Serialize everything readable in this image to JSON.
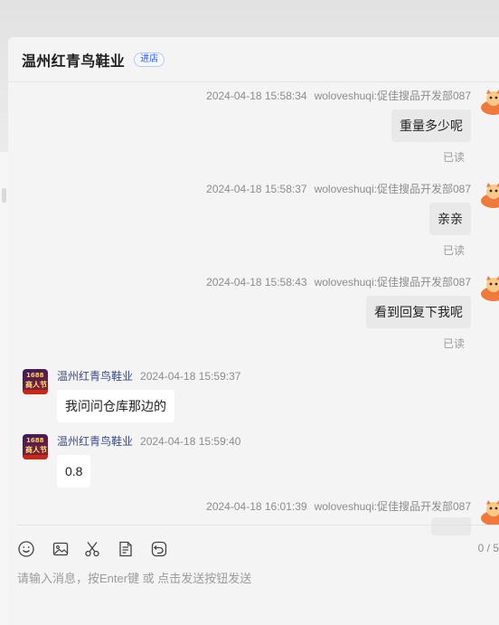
{
  "header": {
    "shop_name": "温州红青鸟鞋业",
    "enter_label": "进店"
  },
  "messages": [
    {
      "side": "right",
      "time": "2024-04-18 15:58:34",
      "sender": "woloveshuqi:促佳搜品开发部087",
      "text": "重量多少呢",
      "status": "已读"
    },
    {
      "side": "right",
      "time": "2024-04-18 15:58:37",
      "sender": "woloveshuqi:促佳搜品开发部087",
      "text": "亲亲",
      "status": "已读"
    },
    {
      "side": "right",
      "time": "2024-04-18 15:58:43",
      "sender": "woloveshuqi:促佳搜品开发部087",
      "text": "看到回复下我呢",
      "status": "已读"
    },
    {
      "side": "left",
      "sender": "温州红青鸟鞋业",
      "time": "2024-04-18 15:59:37",
      "text": "我问问仓库那边的"
    },
    {
      "side": "left",
      "sender": "温州红青鸟鞋业",
      "time": "2024-04-18 15:59:40",
      "text": "0.8"
    },
    {
      "side": "right",
      "time": "2024-04-18 16:01:39",
      "sender": "woloveshuqi:促佳搜品开发部087",
      "text": ""
    }
  ],
  "shop_avatar": {
    "line1": "1688",
    "line2": "商人节"
  },
  "toolbar": {
    "icons": [
      "emoji-icon",
      "image-icon",
      "scissors-icon",
      "document-icon",
      "undo-icon"
    ],
    "counter": "0 / 5"
  },
  "input": {
    "placeholder": "请输入消息，按Enter键 或 点击发送按钮发送"
  },
  "colors": {
    "panel_bg": "#f4f4f4",
    "sent_bubble": "#e9e9e9",
    "received_bubble": "#ffffff",
    "badge_blue": "#2b5bd7",
    "sender_name": "#3a4a8a"
  }
}
